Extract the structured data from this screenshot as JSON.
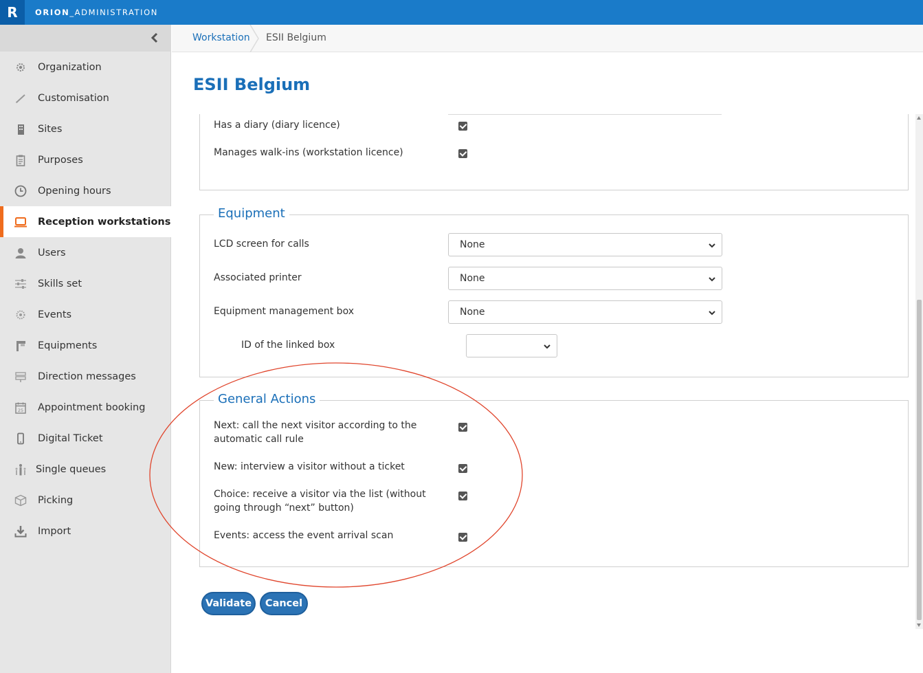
{
  "header": {
    "logo_letter": "R",
    "app_name_bold": "ORION",
    "app_name_rest": "_ADMINISTRATION"
  },
  "sidebar": {
    "items": [
      {
        "label": "Organization",
        "icon": "gear-cog-icon"
      },
      {
        "label": "Customisation",
        "icon": "pen-icon"
      },
      {
        "label": "Sites",
        "icon": "building-icon"
      },
      {
        "label": "Purposes",
        "icon": "clipboard-icon"
      },
      {
        "label": "Opening hours",
        "icon": "clock-icon"
      },
      {
        "label": "Reception workstations",
        "icon": "laptop-icon",
        "active": true
      },
      {
        "label": "Users",
        "icon": "user-icon"
      },
      {
        "label": "Skills set",
        "icon": "sliders-icon"
      },
      {
        "label": "Events",
        "icon": "sparkle-icon"
      },
      {
        "label": "Equipments",
        "icon": "equipment-icon"
      },
      {
        "label": "Direction messages",
        "icon": "signpost-icon"
      },
      {
        "label": "Appointment booking",
        "icon": "calendar-icon",
        "calendar_number": "25"
      },
      {
        "label": "Digital Ticket",
        "icon": "phone-icon"
      },
      {
        "label": "Single queues",
        "icon": "queue-icon"
      },
      {
        "label": "Picking",
        "icon": "box-icon"
      },
      {
        "label": "Import",
        "icon": "download-icon"
      }
    ]
  },
  "breadcrumb": {
    "parent": "Workstation",
    "current": "ESII Belgium"
  },
  "page": {
    "title": "ESII Belgium"
  },
  "licences": {
    "rows": [
      {
        "label": "Has a diary (diary licence)",
        "checked": true
      },
      {
        "label": "Manages walk-ins (workstation licence)",
        "checked": true
      }
    ]
  },
  "equipment": {
    "legend": "Equipment",
    "lcd_label": "LCD screen for calls",
    "lcd_value": "None",
    "printer_label": "Associated printer",
    "printer_value": "None",
    "box_label": "Equipment management box",
    "box_value": "None",
    "linked_box_label": "ID of the linked box",
    "linked_box_value": ""
  },
  "general_actions": {
    "legend": "General Actions",
    "rows": [
      {
        "line1": "Next: call the next visitor according to the",
        "line2": "automatic call rule",
        "checked": true
      },
      {
        "line1": "New: interview a visitor without a ticket",
        "line2": "",
        "checked": true
      },
      {
        "line1": "Choice: receive a visitor via the list (without",
        "line2": "going through “next” button)",
        "checked": true
      },
      {
        "line1": "Events: access the event arrival scan",
        "line2": "",
        "checked": true
      }
    ]
  },
  "buttons": {
    "validate": "Validate",
    "cancel": "Cancel"
  },
  "colors": {
    "brand": "#1a7bc9",
    "accent": "#ef6c1d",
    "annotation": "#e0452c",
    "button": "#2b73b5"
  }
}
